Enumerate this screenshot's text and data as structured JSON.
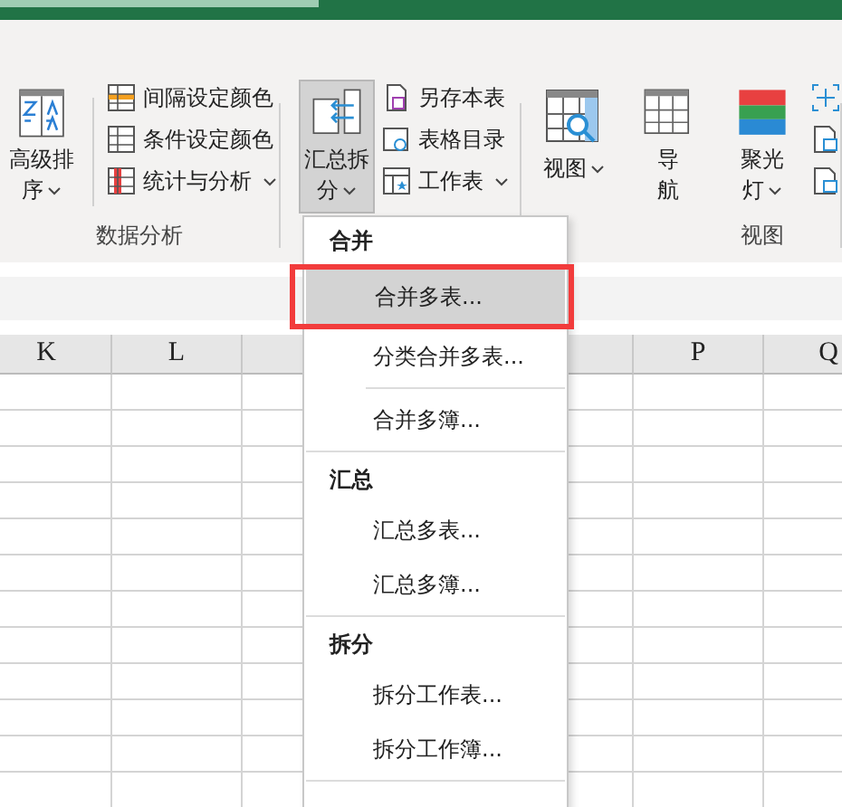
{
  "ribbon": {
    "groups": [
      {
        "label": "数据分析",
        "large": [
          {
            "lines": [
              "高级排",
              "序"
            ],
            "dropdown": true,
            "pressed": false
          }
        ],
        "small": [
          {
            "label": "间隔设定颜色",
            "dropdown": false
          },
          {
            "label": "条件设定颜色",
            "dropdown": false
          },
          {
            "label": "统计与分析",
            "dropdown": true
          }
        ]
      },
      {
        "large": [
          {
            "lines": [
              "汇总拆",
              "分"
            ],
            "dropdown": true,
            "pressed": true
          }
        ],
        "small": [
          {
            "label": "另存本表",
            "dropdown": false
          },
          {
            "label": "表格目录",
            "dropdown": false
          },
          {
            "label": "工作表",
            "dropdown": true
          }
        ]
      },
      {
        "label": "视图",
        "large": [
          {
            "lines": [
              "视图"
            ],
            "dropdown": true,
            "pressed": false
          },
          {
            "lines": [
              "导",
              "航"
            ],
            "dropdown": false,
            "pressed": false
          },
          {
            "lines": [
              "聚光",
              "灯"
            ],
            "dropdown": true,
            "pressed": false
          }
        ]
      }
    ]
  },
  "columns": [
    {
      "label": "K"
    },
    {
      "label": "L"
    },
    {},
    {},
    {},
    {
      "label": "P"
    },
    {
      "label": "Q"
    }
  ],
  "menu": {
    "sections": [
      {
        "title": "合并",
        "items": [
          {
            "label": "合并多表...",
            "selected": true,
            "divider_above": false
          },
          {
            "label": "分类合并多表...",
            "selected": false,
            "divider_above": false
          },
          {
            "label": "合并多簿...",
            "selected": false,
            "divider_above": true
          }
        ]
      },
      {
        "title": "汇总",
        "items": [
          {
            "label": "汇总多表...",
            "selected": false,
            "divider_above": false
          },
          {
            "label": "汇总多簿...",
            "selected": false,
            "divider_above": false
          }
        ]
      },
      {
        "title": "拆分",
        "items": [
          {
            "label": "拆分工作表...",
            "selected": false,
            "divider_above": false
          },
          {
            "label": "拆分工作簿...",
            "selected": false,
            "divider_above": false
          }
        ]
      }
    ]
  }
}
